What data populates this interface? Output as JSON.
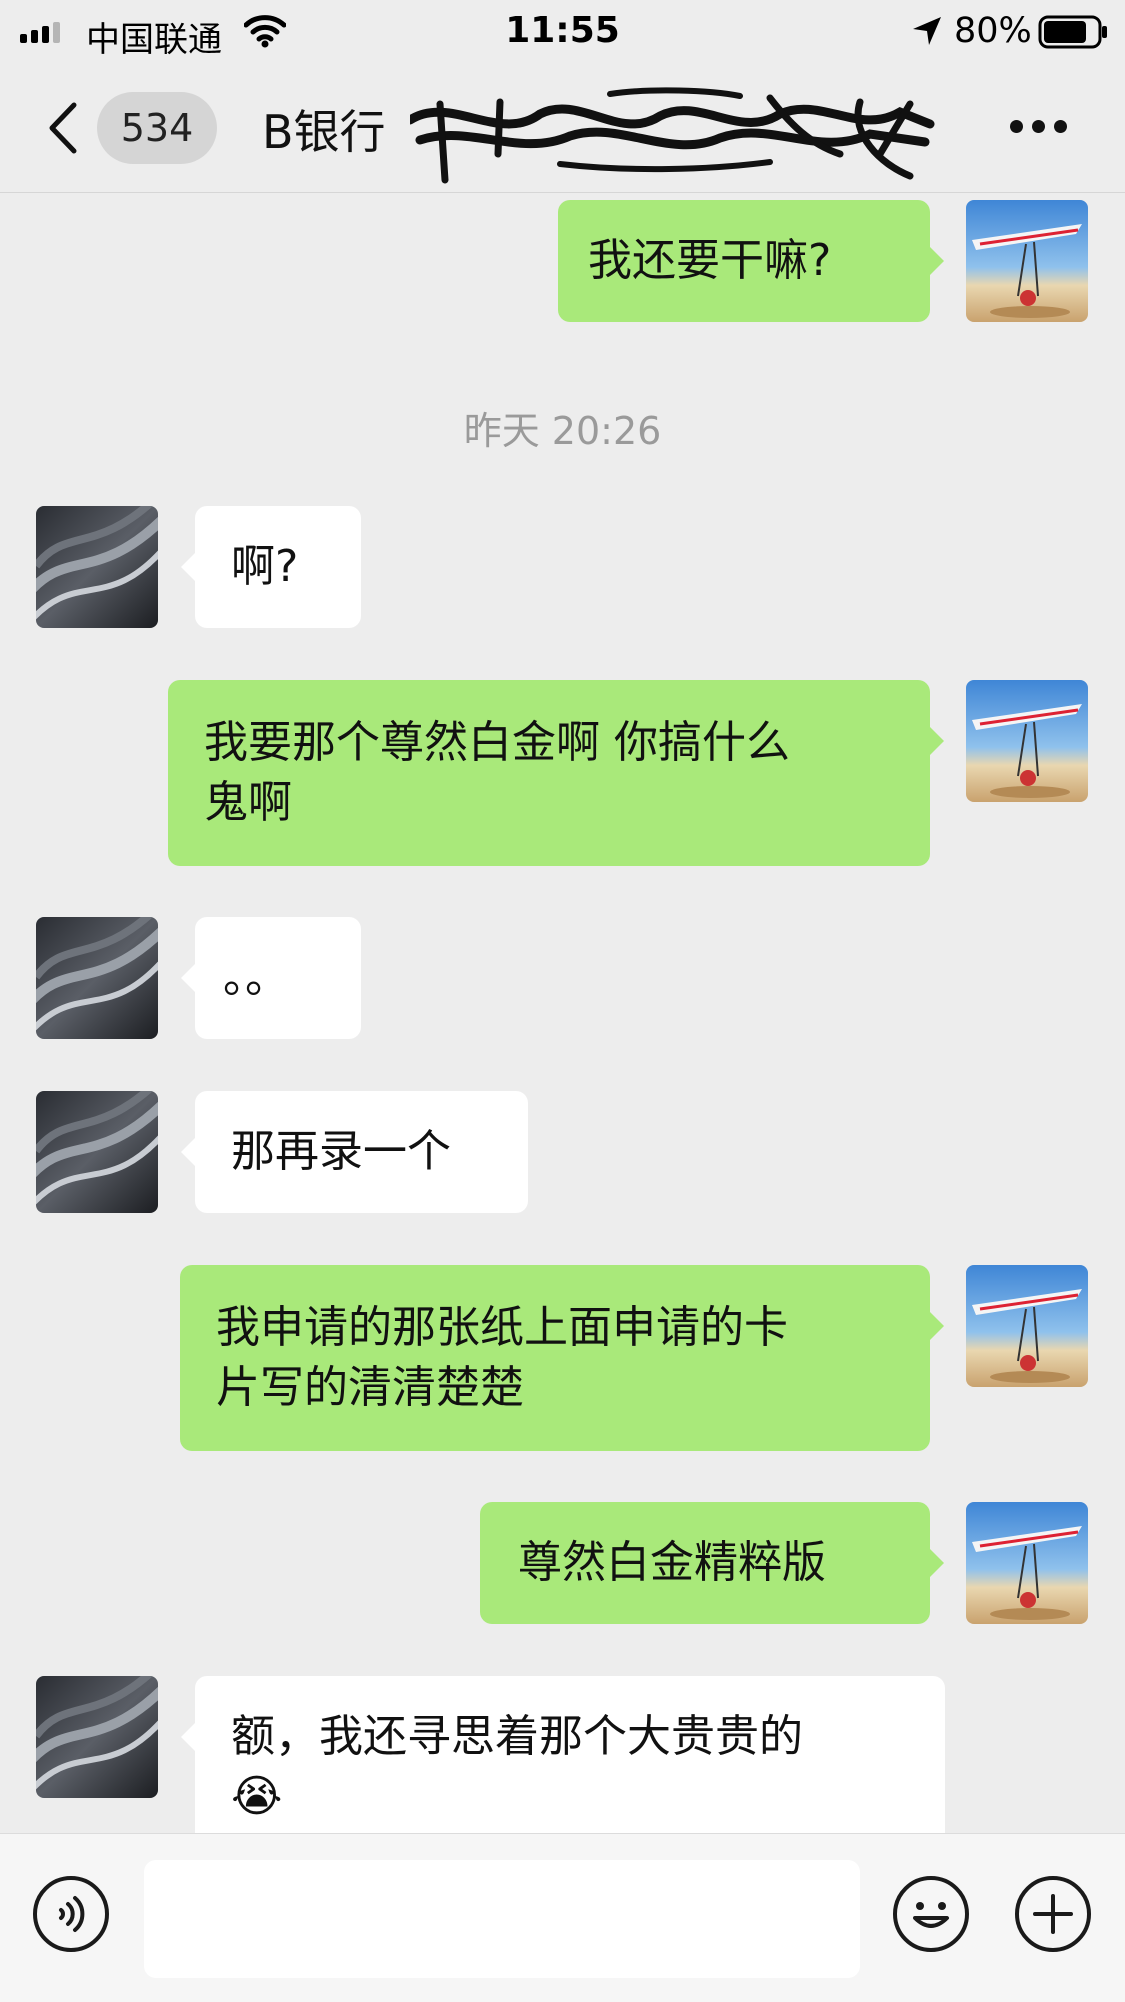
{
  "status_bar": {
    "carrier": "中国联通",
    "time": "11:55",
    "battery": "80%",
    "battery_level": 0.8,
    "signal_bars_active": 3
  },
  "nav": {
    "unread_count": "534",
    "title_visible": "B银行",
    "redacted_icon": "scribble-redaction"
  },
  "messages": [
    {
      "id": "m1",
      "side": "out",
      "lines": [
        "我还要干嘛?"
      ]
    },
    {
      "id": "m2",
      "side": "in",
      "lines": [
        "啊?"
      ]
    },
    {
      "id": "m3",
      "side": "out",
      "lines": [
        "我要那个尊然白金啊 你搞什么",
        "鬼啊"
      ]
    },
    {
      "id": "m4",
      "side": "in",
      "lines": [
        "。。"
      ]
    },
    {
      "id": "m5",
      "side": "in",
      "lines": [
        "那再录一个"
      ]
    },
    {
      "id": "m6",
      "side": "out",
      "lines": [
        "我申请的那张纸上面申请的卡",
        "片写的清清楚楚"
      ]
    },
    {
      "id": "m7",
      "side": "out",
      "lines": [
        "尊然白金精粹版"
      ]
    },
    {
      "id": "m8",
      "side": "in",
      "lines": [
        "额，我还寻思着那个大贵贵的",
        "😭"
      ]
    }
  ],
  "timestamp": "昨天 20:26",
  "input": {
    "value": "",
    "placeholder": ""
  },
  "icons": {
    "back": "chevron-left-icon",
    "more": "more-dots-icon",
    "voice": "voice-icon",
    "emoji": "smiley-icon",
    "plus": "plus-icon"
  },
  "colors": {
    "background": "#ededed",
    "outgoing_bubble": "#a9e97a",
    "incoming_bubble": "#ffffff",
    "timestamp_text": "#9a9a9a"
  }
}
